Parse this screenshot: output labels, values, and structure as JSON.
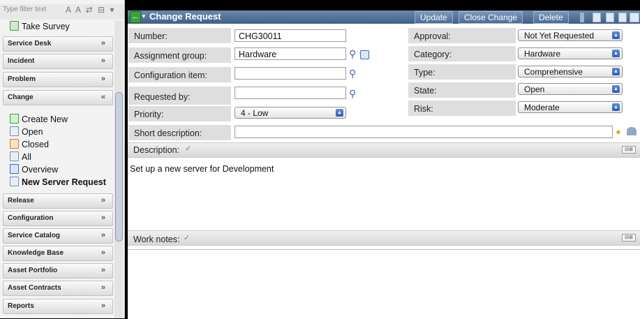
{
  "sidebar": {
    "filter_placeholder": "Type filter text",
    "filter_tools": "A A ⇄ ⊟ ▾",
    "take_survey": "Take Survey",
    "sections": [
      {
        "label": "Service Desk",
        "chevron": "»"
      },
      {
        "label": "Incident",
        "chevron": "»"
      },
      {
        "label": "Problem",
        "chevron": "»"
      },
      {
        "label": "Change",
        "chevron": "«"
      }
    ],
    "change_modules": [
      "Create New",
      "Open",
      "Closed",
      "All",
      "Overview",
      "New Server Request"
    ],
    "sections_after": [
      {
        "label": "Release",
        "chevron": "»"
      },
      {
        "label": "Configuration",
        "chevron": "»"
      },
      {
        "label": "Service Catalog",
        "chevron": "»"
      },
      {
        "label": "Knowledge Base",
        "chevron": "»"
      },
      {
        "label": "Asset Portfolio",
        "chevron": "»"
      },
      {
        "label": "Asset Contracts",
        "chevron": "»"
      },
      {
        "label": "Reports",
        "chevron": "»"
      }
    ]
  },
  "header": {
    "title": "Change Request",
    "buttons": [
      "Update",
      "Close Change",
      "Delete"
    ]
  },
  "form": {
    "left_fields": [
      {
        "label": "Number:",
        "value": "CHG30011"
      },
      {
        "label": "Assignment group:",
        "value": "Hardware"
      },
      {
        "label": "Configuration item:",
        "value": ""
      },
      {
        "label": "Requested by:",
        "value": ""
      },
      {
        "label": "Priority:",
        "value": "4 - Low"
      },
      {
        "label": "Short description:",
        "value": ""
      }
    ],
    "right_fields": [
      {
        "label": "Approval:",
        "value": "Not Yet Requested"
      },
      {
        "label": "Category:",
        "value": "Hardware"
      },
      {
        "label": "Type:",
        "value": "Comprehensive"
      },
      {
        "label": "State:",
        "value": "Open"
      },
      {
        "label": "Risk:",
        "value": "Moderate"
      }
    ],
    "description_label": "Description:",
    "description_text": "Set up a new server for Development",
    "work_notes_label": "Work notes:",
    "work_notes_text": ""
  },
  "colors": {
    "header": "#4b6d94",
    "accent_blue": "#2c5fb5",
    "green": "#3aa33a"
  }
}
